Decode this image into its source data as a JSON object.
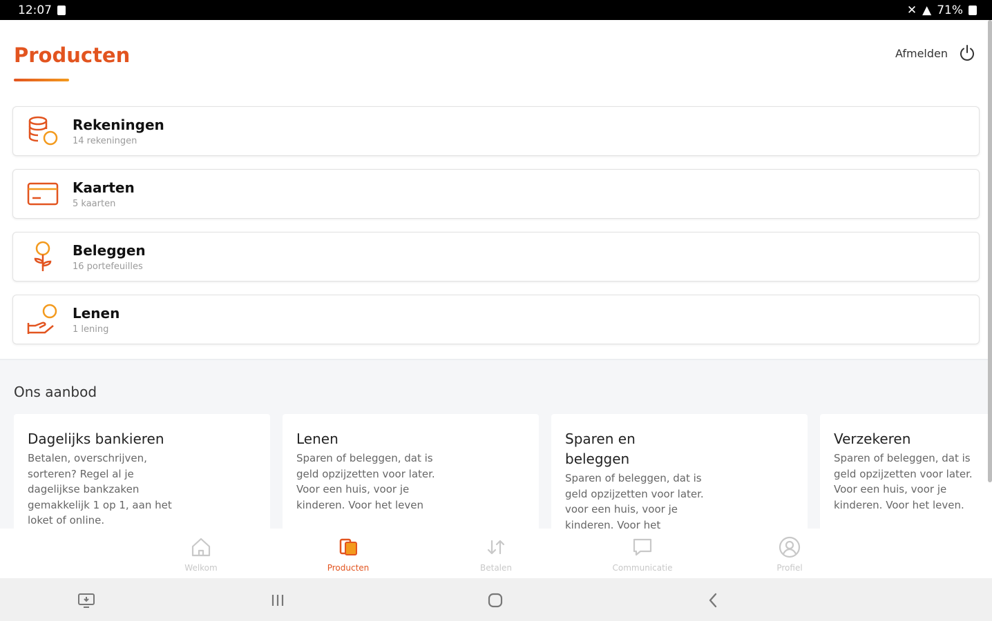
{
  "status_bar": {
    "time": "12:07",
    "battery": "71%"
  },
  "header": {
    "title": "Producten",
    "logout_label": "Afmelden"
  },
  "products": [
    {
      "name": "Rekeningen",
      "subtitle": "14 rekeningen",
      "icon": "coins-stack-icon"
    },
    {
      "name": "Kaarten",
      "subtitle": "5 kaarten",
      "icon": "card-icon"
    },
    {
      "name": "Beleggen",
      "subtitle": "16 portefeuilles",
      "icon": "plant-coin-icon"
    },
    {
      "name": "Lenen",
      "subtitle": "1 lening",
      "icon": "hand-coin-icon"
    }
  ],
  "offer": {
    "title": "Ons aanbod",
    "cards": [
      {
        "title": "Dagelijks bankieren",
        "text": "Betalen, overschrijven, sorteren? Regel al je dagelijkse bankzaken gemakkelijk 1 op 1, aan het loket of online."
      },
      {
        "title": "Lenen",
        "text": "Sparen of beleggen, dat is geld opzijzetten voor later. Voor een huis, voor je kinderen. Voor het leven"
      },
      {
        "title": "Sparen en beleggen",
        "text": "Sparen of beleggen, dat is geld opzijzetten voor later. voor een huis, voor je kinderen. Voor het"
      },
      {
        "title": "Verzekeren",
        "text": "Sparen of beleggen, dat is geld opzijzetten voor later. Voor een huis, voor je kinderen. Voor het leven."
      }
    ]
  },
  "nav": {
    "items": [
      {
        "label": "Welkom",
        "icon": "home-icon"
      },
      {
        "label": "Producten",
        "icon": "products-icon",
        "active": true
      },
      {
        "label": "Betalen",
        "icon": "transfer-arrows-icon"
      },
      {
        "label": "Communicatie",
        "icon": "message-icon"
      },
      {
        "label": "Profiel",
        "icon": "profile-icon"
      }
    ]
  },
  "colors": {
    "accent": "#e2541f",
    "accent_light": "#f39a1d"
  }
}
